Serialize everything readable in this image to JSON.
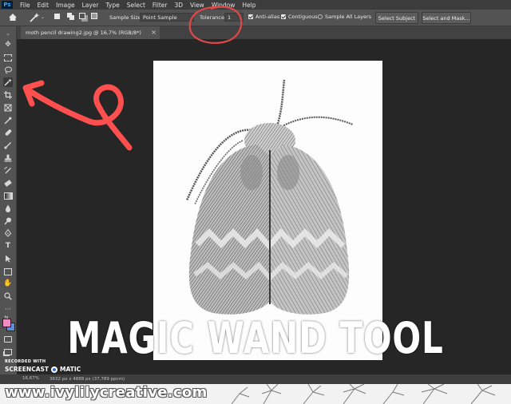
{
  "menu": {
    "logo": "Ps",
    "items": [
      "File",
      "Edit",
      "Image",
      "Layer",
      "Type",
      "Select",
      "Filter",
      "3D",
      "View",
      "Window",
      "Help"
    ]
  },
  "options": {
    "sample_size_label": "Sample Size:",
    "sample_size_value": "Point Sample",
    "tolerance_label": "Tolerance:",
    "tolerance_value": "1",
    "anti_alias_label": "Anti-alias",
    "contiguous_label": "Contiguous",
    "sample_all_layers_label": "Sample All Layers",
    "select_subject_label": "Select Subject",
    "select_mask_label": "Select and Mask..."
  },
  "document": {
    "tab_title": "moth pencil drawing2.jpg @ 16,7% (RGB/8*)",
    "close_symbol": "×"
  },
  "status": {
    "zoom": "16,67%",
    "doc_size": "3632 px x 4888 px (37,789 ppcm)"
  },
  "overlay": {
    "headline": "MAGIC WAND TOOL",
    "site": "www.ivylilycreative.com",
    "recorded_with": "RECORDED WITH",
    "screencast_left": "SCREENCAST",
    "screencast_right": "MATIC"
  },
  "colors": {
    "foreground": "#f08dc0",
    "background": "#5a8fd8",
    "annotation": "#ff4f4f"
  },
  "icons": [
    "home-icon",
    "magic-wand-icon",
    "move-icon",
    "marquee-icon",
    "lasso-icon",
    "crop-icon",
    "eyedropper-icon",
    "brush-icon",
    "stamp-icon",
    "eraser-icon",
    "gradient-icon",
    "pen-icon",
    "type-icon",
    "hand-icon",
    "zoom-icon"
  ]
}
